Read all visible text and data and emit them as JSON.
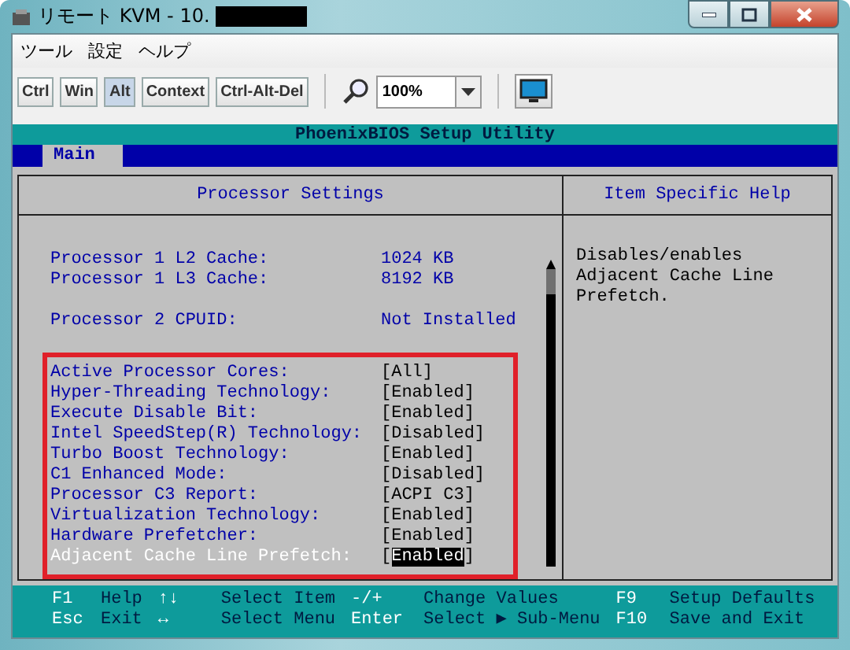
{
  "window": {
    "title": "リモート KVM - 10.",
    "title_redacted": true
  },
  "menu": [
    "ツール",
    "設定",
    "ヘルプ"
  ],
  "toolbar": {
    "keys": [
      {
        "label": "Ctrl",
        "pressed": false
      },
      {
        "label": "Win",
        "pressed": false
      },
      {
        "label": "Alt",
        "pressed": true
      },
      {
        "label": "Context",
        "pressed": false
      },
      {
        "label": "Ctrl-Alt-Del",
        "pressed": false
      }
    ],
    "zoom": "100%"
  },
  "bios": {
    "title": "PhoenixBIOS Setup Utility",
    "tabs": [
      {
        "label": "Main",
        "selected": true
      }
    ],
    "panel_title": "Processor Settings",
    "help_title": "Item Specific Help",
    "help_text": "Disables/enables Adjacent Cache Line Prefetch.",
    "info_groups": [
      [
        {
          "label": "Processor 1 L2 Cache:",
          "value": "1024 KB"
        },
        {
          "label": "Processor 1 L3 Cache:",
          "value": "8192 KB"
        }
      ],
      [
        {
          "label": "Processor 2 CPUID:",
          "value": "Not Installed"
        }
      ]
    ],
    "settings": [
      {
        "label": "Active Processor Cores:",
        "open": "[",
        "value": "All",
        "close": "]",
        "selected": false
      },
      {
        "label": "Hyper-Threading Technology:",
        "open": "[",
        "value": "Enabled",
        "close": "]",
        "selected": false
      },
      {
        "label": "Execute Disable Bit:",
        "open": "[",
        "value": "Enabled",
        "close": "]",
        "selected": false
      },
      {
        "label": "Intel SpeedStep(R) Technology:",
        "open": "[",
        "value": "Disabled",
        "close": "]",
        "selected": false
      },
      {
        "label": "Turbo Boost Technology:",
        "open": "[",
        "value": "Enabled",
        "close": "]",
        "selected": false
      },
      {
        "label": "C1 Enhanced Mode:",
        "open": "[",
        "value": "Disabled",
        "close": "]",
        "selected": false
      },
      {
        "label": "Processor C3 Report:",
        "open": "[",
        "value": "ACPI C3",
        "close": "]",
        "selected": false
      },
      {
        "label": "Virtualization Technology:",
        "open": "[",
        "value": "Enabled",
        "close": "]",
        "selected": false
      },
      {
        "label": "Hardware Prefetcher:",
        "open": "[",
        "value": "Enabled",
        "close": "]",
        "selected": false
      },
      {
        "label": "Adjacent Cache Line Prefetch:",
        "open": "[",
        "value": "Enabled",
        "close": "]",
        "selected": true
      }
    ],
    "footer": [
      [
        {
          "key": "F1",
          "action": "Help"
        },
        {
          "key": "↑↓",
          "action": "Select Item"
        },
        {
          "key": "-/+",
          "action": "Change Values"
        },
        {
          "key": "F9",
          "action": "Setup Defaults"
        }
      ],
      [
        {
          "key": "Esc",
          "action": "Exit"
        },
        {
          "key": "↔",
          "action": "Select Menu"
        },
        {
          "key": "Enter",
          "action": "Select ▶ Sub-Menu"
        },
        {
          "key": "F10",
          "action": "Save and Exit"
        }
      ]
    ]
  }
}
